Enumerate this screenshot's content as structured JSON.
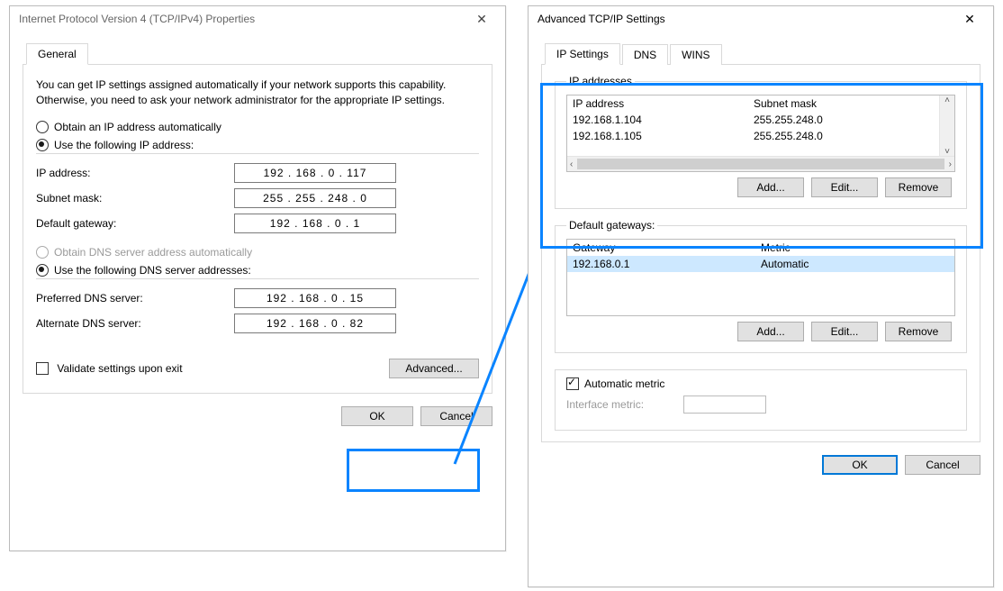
{
  "ipv4": {
    "title": "Internet Protocol Version 4 (TCP/IPv4) Properties",
    "tab_general": "General",
    "intro": "You can get IP settings assigned automatically if your network supports this capability. Otherwise, you need to ask your network administrator for the appropriate IP settings.",
    "radio_obtain_ip": "Obtain an IP address automatically",
    "radio_use_ip": "Use the following IP address:",
    "lbl_ip": "IP address:",
    "val_ip": "192 . 168 .  0  . 117",
    "lbl_mask": "Subnet mask:",
    "val_mask": "255 . 255 . 248 .  0",
    "lbl_gateway": "Default gateway:",
    "val_gateway": "192 . 168 .  0  .  1",
    "radio_obtain_dns": "Obtain DNS server address automatically",
    "radio_use_dns": "Use the following DNS server addresses:",
    "lbl_pref_dns": "Preferred DNS server:",
    "val_pref_dns": "192 . 168 .  0  .  15",
    "lbl_alt_dns": "Alternate DNS server:",
    "val_alt_dns": "192 . 168 .  0  .  82",
    "chk_validate": "Validate settings upon exit",
    "btn_advanced": "Advanced...",
    "btn_ok": "OK",
    "btn_cancel": "Cancel"
  },
  "adv": {
    "title": "Advanced TCP/IP Settings",
    "tab_ip": "IP Settings",
    "tab_dns": "DNS",
    "tab_wins": "WINS",
    "grp_ip": "IP addresses",
    "col_ip": "IP address",
    "col_mask": "Subnet mask",
    "ip_rows": [
      {
        "ip": "192.168.1.104",
        "mask": "255.255.248.0"
      },
      {
        "ip": "192.168.1.105",
        "mask": "255.255.248.0"
      }
    ],
    "grp_gw": "Default gateways:",
    "col_gw": "Gateway",
    "col_metric": "Metric",
    "gw_rows": [
      {
        "gw": "192.168.0.1",
        "metric": "Automatic"
      }
    ],
    "btn_add": "Add...",
    "btn_edit": "Edit...",
    "btn_remove": "Remove",
    "chk_autometric": "Automatic metric",
    "lbl_ifmetric": "Interface metric:",
    "btn_ok": "OK",
    "btn_cancel": "Cancel"
  },
  "colors": {
    "highlight": "#0a84ff",
    "accent": "#0078d7"
  }
}
